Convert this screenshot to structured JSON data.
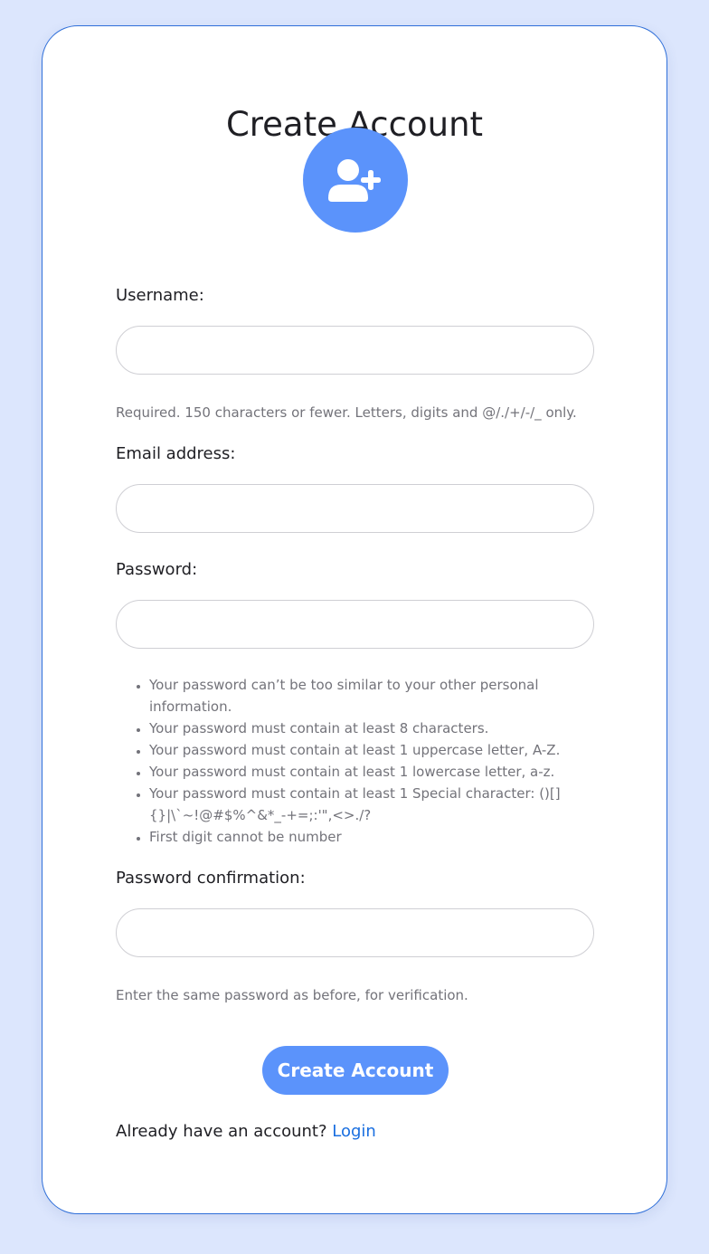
{
  "page": {
    "title": "Create Account"
  },
  "avatar": {
    "icon": "user-plus-icon",
    "color": "#5b93fb"
  },
  "form": {
    "username": {
      "label": "Username:",
      "value": "",
      "help": "Required. 150 characters or fewer. Letters, digits and @/./+/-/_ only."
    },
    "email": {
      "label": "Email address:",
      "value": ""
    },
    "password": {
      "label": "Password:",
      "value": "",
      "rules": [
        "Your password can’t be too similar to your other personal information.",
        "Your password must contain at least 8 characters.",
        "Your password must contain at least 1 uppercase letter, A-Z.",
        "Your password must contain at least 1 lowercase letter, a-z.",
        "Your password must contain at least 1 Special character: ()[]{}|\\`~!@#$%^&*_-+=;:'\",<>./?",
        "First digit cannot be number"
      ]
    },
    "password_confirmation": {
      "label": "Password confirmation:",
      "value": "",
      "help": "Enter the same password as before, for verification."
    },
    "submit_label": "Create Account"
  },
  "footer": {
    "prompt": "Already have an account? ",
    "login_label": "Login"
  },
  "colors": {
    "background": "#dce6fd",
    "accent": "#5b93fb",
    "link": "#1a6fe0",
    "card_border": "#2f6fd9"
  }
}
